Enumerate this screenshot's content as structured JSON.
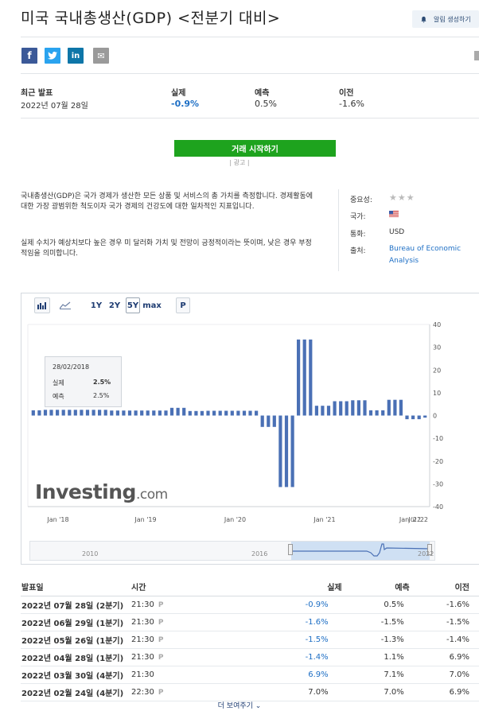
{
  "page": {
    "title": "미국 국내총생산(GDP) <전분기 대비>",
    "alert_label": "알림 생성하기"
  },
  "share": {
    "facebook": "f",
    "twitter": "t",
    "linkedin": "in",
    "email": "✉"
  },
  "latest": {
    "release_label": "최근 발표",
    "release_date": "2022년 07월 28일",
    "actual_label": "실제",
    "actual_value": "-0.9%",
    "forecast_label": "예측",
    "forecast_value": "0.5%",
    "previous_label": "이전",
    "previous_value": "-1.6%"
  },
  "trade": {
    "button_label": "거래 시작하기",
    "ad_label": "| 광고 |"
  },
  "description": {
    "para1": "국내총생산(GDP)은 국가 경제가 생산한 모든 상품 및 서비스의 총 가치를 측정합니다. 경제활동에 대한 가장 광범위한 척도이자 국가 경제의 건강도에 대한 일차적인 지표입니다.",
    "para2": "실제 수치가 예상치보다 높은 경우 미 달러화 가치 및 전망이 긍정적이라는 뜻이며, 낮은 경우 부정적임을 의미합니다."
  },
  "info": {
    "importance_label": "중요성:",
    "importance_stars": "★★★",
    "country_label": "국가:",
    "currency_label": "통화:",
    "currency_value": "USD",
    "source_label": "출처:",
    "source_line1": "Bureau of Economic",
    "source_line2": "Analysis"
  },
  "toolbar": {
    "range_1y": "1Y",
    "range_2y": "2Y",
    "range_5y": "5Y",
    "range_max": "max",
    "p_label": "P",
    "bar_icon": "bar-chart-icon",
    "area_icon": "area-chart-icon"
  },
  "tooltip": {
    "date": "28/02/2018",
    "actual_label": "실제",
    "actual_value": "2.5%",
    "forecast_label": "예측",
    "forecast_value": "2.5%"
  },
  "watermark": {
    "brand": "Investing",
    "domain": ".com"
  },
  "navigator": {
    "label_left": "2010",
    "label_mid": "2016",
    "label_right": "2022"
  },
  "chart_data": {
    "type": "bar",
    "xlabel": "",
    "ylabel": "",
    "ylim": [
      -40,
      40
    ],
    "yticks": [
      40,
      30,
      20,
      10,
      0,
      -10,
      -20,
      -30,
      -40
    ],
    "xtick_labels": [
      "Jan '18",
      "Jan '19",
      "Jan '20",
      "Jan '21",
      "Jan '22",
      "Jul '22"
    ],
    "bar_color": "#4a70b5",
    "series": [
      {
        "values": [
          2.3,
          2.3,
          2.5,
          2.5,
          2.5,
          2.5,
          2.5,
          2.5,
          2.5,
          2.5,
          2.5,
          2.5,
          2.5,
          2.2,
          2.2,
          2.2,
          2.2,
          2.2,
          2.2,
          2.2,
          2.2,
          2.2,
          2.2,
          3.4,
          3.4,
          3.4,
          2.0,
          2.0,
          2.0,
          2.1,
          2.1,
          2.1,
          2.1,
          2.1,
          2.1,
          2.1,
          2.1,
          2.1,
          -5.0,
          -5.0,
          -5.0,
          -31.4,
          -31.4,
          -31.4,
          33.4,
          33.4,
          33.4,
          4.3,
          4.3,
          4.3,
          6.3,
          6.3,
          6.3,
          6.7,
          6.7,
          6.7,
          2.3,
          2.3,
          2.3,
          6.9,
          6.9,
          6.9,
          -1.6,
          -1.6,
          -1.6,
          -0.9
        ]
      }
    ]
  },
  "history": {
    "headers": [
      "발표일",
      "시간",
      "실제",
      "예측",
      "이전"
    ],
    "rows": [
      {
        "date": "2022년 07월 28일 (2분기)",
        "time": "21:30",
        "actual": "-0.9%",
        "forecast": "0.5%",
        "previous": "-1.6%",
        "actual_color": "blue"
      },
      {
        "date": "2022년 06월 29일 (1분기)",
        "time": "21:30",
        "actual": "-1.6%",
        "forecast": "-1.5%",
        "previous": "-1.5%",
        "actual_color": "blue"
      },
      {
        "date": "2022년 05월 26일 (1분기)",
        "time": "21:30",
        "actual": "-1.5%",
        "forecast": "-1.3%",
        "previous": "-1.4%",
        "actual_color": "blue"
      },
      {
        "date": "2022년 04월 28일 (1분기)",
        "time": "21:30",
        "actual": "-1.4%",
        "forecast": "1.1%",
        "previous": "6.9%",
        "actual_color": "blue"
      },
      {
        "date": "2022년 03월 30일 (4분기)",
        "time": "21:30",
        "actual": "6.9%",
        "forecast": "7.1%",
        "previous": "7.0%",
        "actual_color": "blue"
      },
      {
        "date": "2022년 02월 24일 (4분기)",
        "time": "22:30",
        "actual": "7.0%",
        "forecast": "7.0%",
        "previous": "6.9%",
        "actual_color": "black"
      }
    ],
    "more_label": "더 보여주기 ⌄"
  }
}
